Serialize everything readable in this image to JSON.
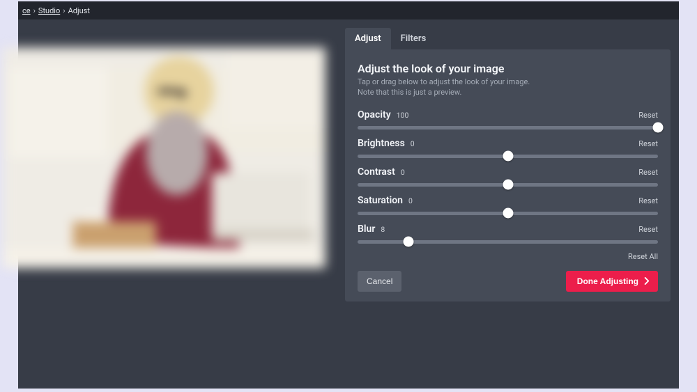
{
  "colors": {
    "accent": "#ec1e4b"
  },
  "breadcrumb": {
    "item0": "ce",
    "item1": "Studio",
    "item2": "Adjust"
  },
  "tabs": {
    "adjust": "Adjust",
    "filters": "Filters"
  },
  "panel": {
    "title": "Adjust the look of your image",
    "desc_line1": "Tap or drag below to adjust the look of your image.",
    "desc_line2": "Note that this is just a preview."
  },
  "sliders": {
    "opacity": {
      "label": "Opacity",
      "value": "100",
      "reset": "Reset",
      "thumb_pct": 100
    },
    "brightness": {
      "label": "Brightness",
      "value": "0",
      "reset": "Reset",
      "thumb_pct": 50
    },
    "contrast": {
      "label": "Contrast",
      "value": "0",
      "reset": "Reset",
      "thumb_pct": 50
    },
    "saturation": {
      "label": "Saturation",
      "value": "0",
      "reset": "Reset",
      "thumb_pct": 50
    },
    "blur": {
      "label": "Blur",
      "value": "8",
      "reset": "Reset",
      "thumb_pct": 17
    }
  },
  "reset_all": "Reset All",
  "actions": {
    "cancel": "Cancel",
    "done": "Done Adjusting"
  }
}
